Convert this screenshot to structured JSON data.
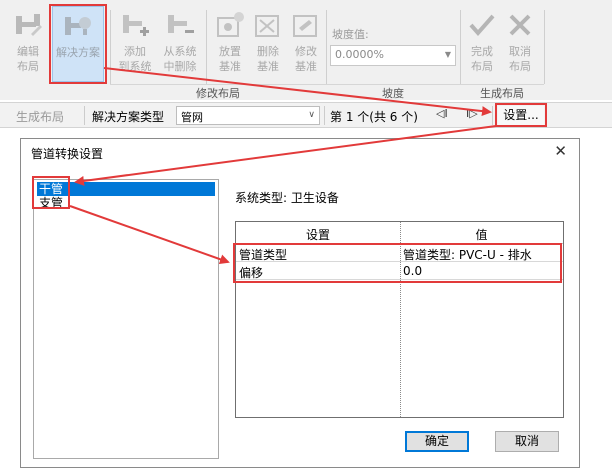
{
  "ribbon": {
    "buttons": [
      {
        "label1": "编辑",
        "label2": "布局"
      },
      {
        "label1": "解决方案",
        "label2": ""
      },
      {
        "label1": "添加",
        "label2": "到系统"
      },
      {
        "label1": "从系统",
        "label2": "中删除"
      },
      {
        "label1": "放置",
        "label2": "基准"
      },
      {
        "label1": "删除",
        "label2": "基准"
      },
      {
        "label1": "修改",
        "label2": "基准"
      },
      {
        "label1": "完成",
        "label2": "布局"
      },
      {
        "label1": "取消",
        "label2": "布局"
      }
    ],
    "slope_label": "坡度值:",
    "slope_value": "0.0000%",
    "groups": {
      "modify": "修改布局",
      "slope": "坡度",
      "generate": "生成布局"
    }
  },
  "options_bar": {
    "generate_layout": "生成布局",
    "solution_type_label": "解决方案类型",
    "solution_type_value": "管网",
    "counter": "第 1 个(共 6 个)",
    "prev_glyph": "◁I",
    "next_glyph": "I▷",
    "settings": "设置..."
  },
  "dialog": {
    "title": "管道转换设置",
    "close_glyph": "✕",
    "tree": [
      "干管",
      "支管"
    ],
    "system_type": "系统类型:  卫生设备",
    "table": {
      "headers": [
        "设置",
        "值"
      ],
      "rows": [
        {
          "key": "管道类型",
          "value": "管道类型: PVC-U - 排水"
        },
        {
          "key": "偏移",
          "value": "0.0"
        }
      ]
    },
    "ok": "确定",
    "cancel": "取消"
  },
  "colors": {
    "annotation": "#e23a3a",
    "selection": "#0078d7",
    "ribbon_bg": "#f0f0f0"
  }
}
